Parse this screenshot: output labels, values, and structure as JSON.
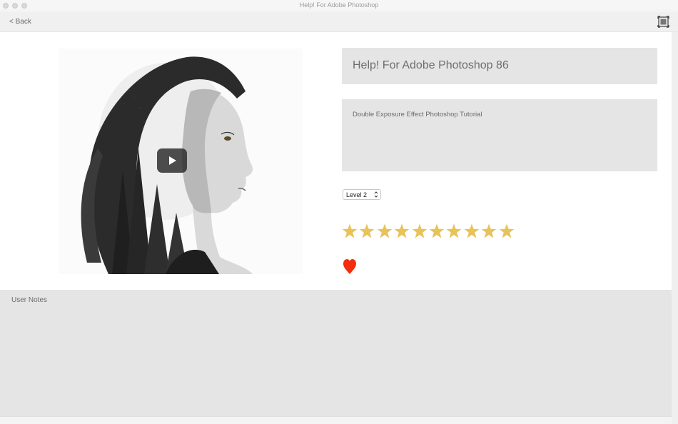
{
  "window": {
    "title": "Help! For Adobe Photoshop"
  },
  "toolbar": {
    "back_label": "< Back",
    "fullscreen_icon": "fullscreen-icon"
  },
  "video": {
    "thumbnail_description": "double-exposure-portrait",
    "play_icon": "play-icon"
  },
  "detail": {
    "title": "Help! For Adobe Photoshop 86",
    "description": "Double Exposure Effect Photoshop Tutorial",
    "level": {
      "selected": "Level 2"
    },
    "rating": {
      "stars": 10,
      "max": 10,
      "color": "#E8C35A"
    },
    "favorite": {
      "icon": "heart-icon",
      "color": "#F22E0C"
    }
  },
  "notes": {
    "label": "User Notes"
  }
}
